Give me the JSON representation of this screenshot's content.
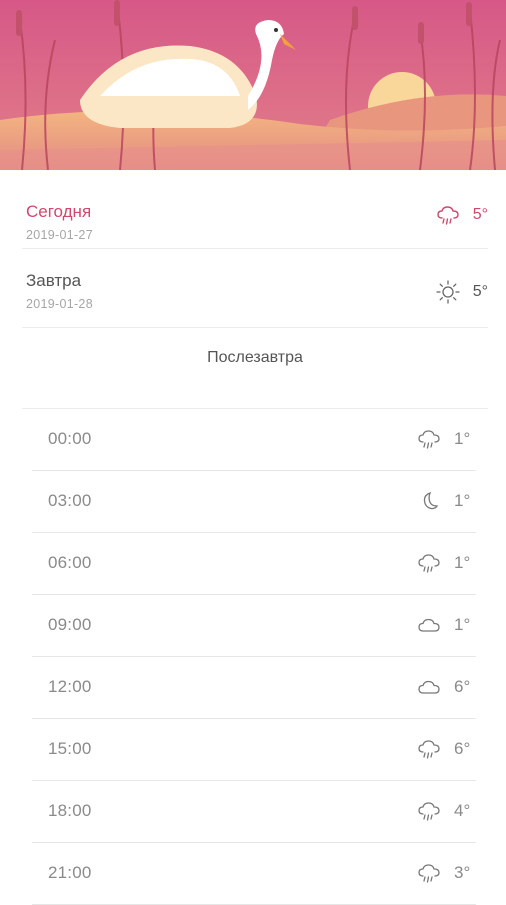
{
  "colors": {
    "accent": "#d2476d",
    "text": "#555555",
    "muted": "#8a8a8a",
    "hero_sky": "#d45f86"
  },
  "days": [
    {
      "label": "Сегодня",
      "date": "2019-01-27",
      "temp": "5°",
      "icon": "rain-cloud-icon",
      "selected": true
    },
    {
      "label": "Завтра",
      "date": "2019-01-28",
      "temp": "5°",
      "icon": "sun-icon",
      "selected": false
    }
  ],
  "after_tomorrow": {
    "label": "Послезавтра"
  },
  "hours": [
    {
      "time": "00:00",
      "temp": "1°",
      "icon": "rain-cloud-icon"
    },
    {
      "time": "03:00",
      "temp": "1°",
      "icon": "moon-icon"
    },
    {
      "time": "06:00",
      "temp": "1°",
      "icon": "rain-cloud-icon"
    },
    {
      "time": "09:00",
      "temp": "1°",
      "icon": "cloud-icon"
    },
    {
      "time": "12:00",
      "temp": "6°",
      "icon": "cloud-icon"
    },
    {
      "time": "15:00",
      "temp": "6°",
      "icon": "rain-cloud-icon"
    },
    {
      "time": "18:00",
      "temp": "4°",
      "icon": "rain-cloud-icon"
    },
    {
      "time": "21:00",
      "temp": "3°",
      "icon": "rain-cloud-icon"
    }
  ]
}
